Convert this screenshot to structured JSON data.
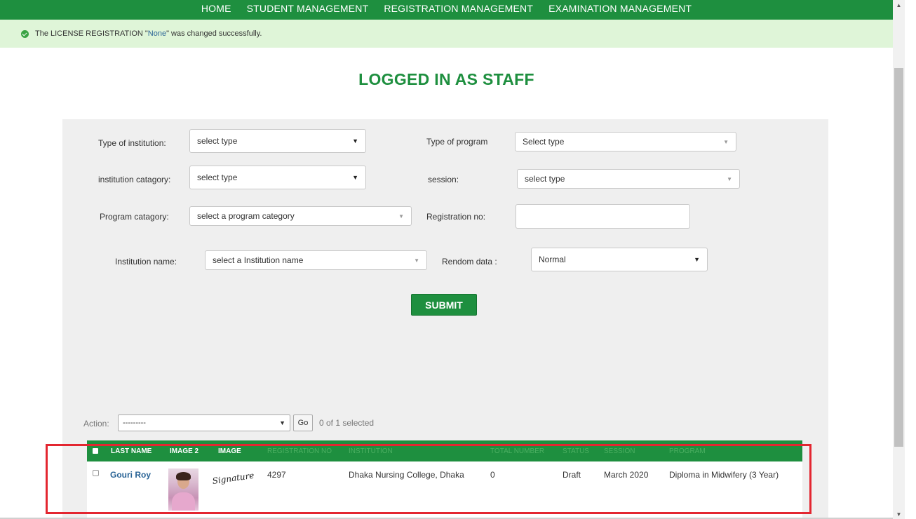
{
  "nav": {
    "items": [
      "HOME",
      "STUDENT MANAGEMENT",
      "REGISTRATION MANAGEMENT",
      "EXAMINATION MANAGEMENT"
    ]
  },
  "message": {
    "prefix": "The LICENSE REGISTRATION \"",
    "link": "None",
    "suffix": "\" was changed successfully."
  },
  "title": "LOGGED IN AS STAFF",
  "filters": {
    "type_of_institution": {
      "label": "Type of institution:",
      "value": "select type"
    },
    "type_of_program": {
      "label": "Type of program",
      "value": "Select type"
    },
    "institution_category": {
      "label": "institution catagory:",
      "value": "select type"
    },
    "session": {
      "label": "session:",
      "value": "select type"
    },
    "program_category": {
      "label": "Program catagory:",
      "value": "select a program category"
    },
    "registration_no": {
      "label": "Registration no:",
      "value": ""
    },
    "institution_name": {
      "label": "Institution name:",
      "value": "select a Institution name"
    },
    "random_data": {
      "label": "Rendom data :",
      "value": "Normal"
    }
  },
  "submit_label": "SUBMIT",
  "action": {
    "label": "Action:",
    "value": "---------",
    "go_label": "Go",
    "selected_count": "0 of 1 selected"
  },
  "table": {
    "headers": {
      "last_name": "LAST NAME",
      "image2": "IMAGE 2",
      "image": "IMAGE",
      "registration_no": "REGISTRATION NO",
      "institution": "INSTITUTION",
      "total_mark": "TOTAL NUMBER",
      "status": "STATUS",
      "session": "SESSION",
      "program": "PROGRAM"
    },
    "rows": [
      {
        "last_name": "Gouri Roy",
        "signature": "Signature",
        "registration_no": "4297",
        "institution": "Dhaka Nursing College, Dhaka",
        "total_mark": "0",
        "status": "Draft",
        "session": "March 2020",
        "program": "Diploma in Midwifery (3 Year)"
      }
    ]
  },
  "colors": {
    "brand_green": "#1e8f3f",
    "success_bg": "#dff5d8",
    "highlight_red": "#e32630"
  }
}
